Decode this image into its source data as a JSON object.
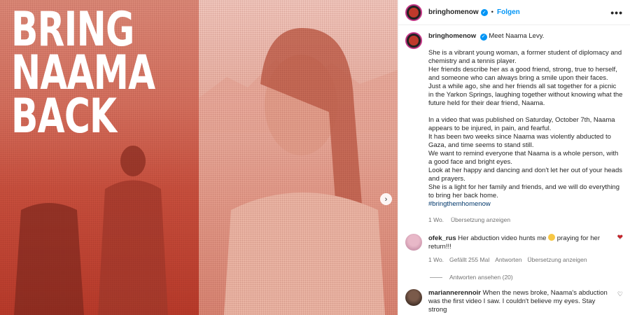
{
  "media": {
    "headline": [
      "BRING",
      "NAAMA",
      "BACK"
    ],
    "next_icon": "chevron-right-icon"
  },
  "header": {
    "username": "bringhomenow",
    "separator": "•",
    "follow_label": "Folgen",
    "more_icon": "•••"
  },
  "caption": {
    "username": "bringhomenow",
    "intro": "Meet Naama Levy.",
    "paragraphs": [
      "She is a vibrant young woman, a former student of diplomacy and chemistry and a tennis player.",
      "Her friends describe her as a good friend, strong, true to herself, and someone who can always bring a smile upon their faces.",
      "Just a while ago, she and her friends all sat together for a picnic in the Yarkon Springs, laughing together without knowing what the future held for their dear friend, Naama.",
      "",
      "In a video that was published on Saturday, October 7th, Naama appears to be injured, in pain, and fearful.",
      "It has been two weeks since Naama was violently abducted to Gaza, and time seems to stand still.",
      "We want to remind everyone that Naama is a whole person, with a good face and bright eyes.",
      "Look at her happy and dancing and don't let her out of your heads and prayers.",
      "She is a light for her family and friends, and we will do everything to bring her back home."
    ],
    "hashtag": "#bringthemhomenow",
    "time": "1 Wo.",
    "translate": "Übersetzung anzeigen"
  },
  "comments": [
    {
      "username": "ofek_rus",
      "text_before": "Her abduction video hunts me",
      "text_after": "praying for her return!!!",
      "time": "1 Wo.",
      "likes": "Gefällt 255 Mal",
      "reply": "Antworten",
      "translate": "Übersetzung anzeigen",
      "view_replies": "Antworten ansehen (20)"
    },
    {
      "username": "mariannerennoir",
      "text": "When the news broke, Naama's abduction was the first video I saw. I couldn't believe my eyes. Stay strong"
    }
  ],
  "colors": {
    "link": "#0095f6",
    "hashtag": "#00376b",
    "muted": "#737373",
    "poster_red": "#c8503e"
  }
}
